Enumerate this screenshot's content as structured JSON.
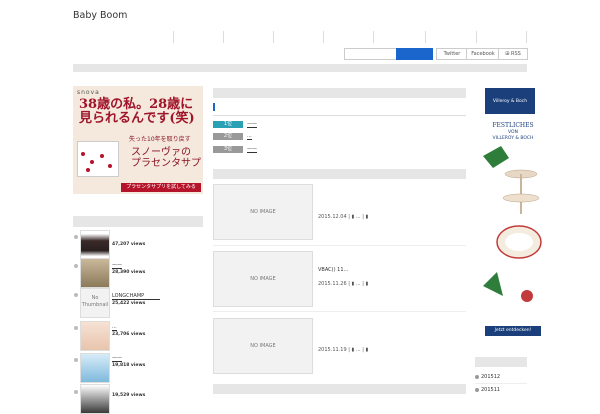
{
  "site": {
    "title": "Baby Boom"
  },
  "header": {
    "social": [
      "Twitter",
      "Facebook",
      "RSS"
    ]
  },
  "left_ad": {
    "logo": "snova",
    "headline": "38歳の私。28歳に",
    "headline2": "見られるんです(笑)",
    "sub": "失った10年を取り戻す",
    "product": "スノーヴァの\nプラセンタサプリ",
    "cta": "プラセンタサプリを試してみる"
  },
  "ranking": [
    {
      "label": "1位",
      "text": "——",
      "color": "#2aa0b5"
    },
    {
      "label": "2位",
      "text": "...",
      "color": "#999999"
    },
    {
      "label": "3位",
      "text": "——",
      "color": "#999999"
    }
  ],
  "posts": [
    {
      "thumb": "NO IMAGE",
      "title": "",
      "date": "2015.12.04"
    },
    {
      "thumb": "NO IMAGE",
      "title": "VBAC() 11...",
      "date": "2015.11.26"
    },
    {
      "thumb": "NO IMAGE",
      "title": "",
      "date": "2015.11.19"
    }
  ],
  "popular": [
    {
      "views": "47,207 views",
      "title": ""
    },
    {
      "views": "28,390 views",
      "title": "——"
    },
    {
      "views": "25,422 views",
      "title": "LONGCHAMP",
      "thumb_text": "No Thumbnail"
    },
    {
      "views": "23,706 views",
      "title": "..."
    },
    {
      "views": "19,818 views",
      "title": "——"
    },
    {
      "views": "19,529 views",
      "title": ""
    }
  ],
  "right_ad": {
    "brand": "Villeroy & Boch",
    "heading": "FESTLICHES",
    "von": "VON",
    "brand2": "VILLEROY & BOCH",
    "cta": "Jetzt entdecken!"
  },
  "archives": [
    {
      "label": "201512"
    },
    {
      "label": "201511"
    }
  ]
}
